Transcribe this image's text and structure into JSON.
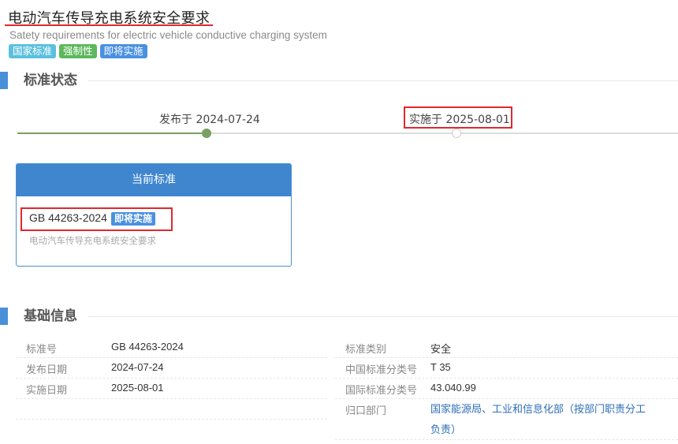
{
  "header": {
    "title": "电动汽车传导充电系统安全要求",
    "subtitle": "Satety requirements for electric vehicle conductive charging system",
    "tags": [
      {
        "label": "国家标准",
        "color": "#5bc0de"
      },
      {
        "label": "强制性",
        "color": "#5cb85c"
      },
      {
        "label": "即将实施",
        "color": "#4a90e2"
      }
    ]
  },
  "status_section": {
    "title": "标准状态",
    "published_label": "发布于 2024-07-24",
    "effective_label": "实施于 2025-08-01"
  },
  "current_card": {
    "header": "当前标准",
    "code": "GB 44263-2024",
    "badge": "即将实施",
    "name": "电动汽车传导充电系统安全要求"
  },
  "basic_section": {
    "title": "基础信息",
    "left_rows": [
      {
        "label": "标准号",
        "value": "GB 44263-2024"
      },
      {
        "label": "发布日期",
        "value": "2024-07-24"
      },
      {
        "label": "实施日期",
        "value": "2025-08-01"
      }
    ],
    "right_rows": [
      {
        "label": "标准类别",
        "value": "安全"
      },
      {
        "label": "中国标准分类号",
        "value": "T 35"
      },
      {
        "label": "国际标准分类号",
        "value": "43.040.99"
      },
      {
        "label": "归口部门",
        "value_line1": "国家能源局、工业和信息化部（按部门职责分工",
        "value_line2": "负责）"
      }
    ]
  }
}
